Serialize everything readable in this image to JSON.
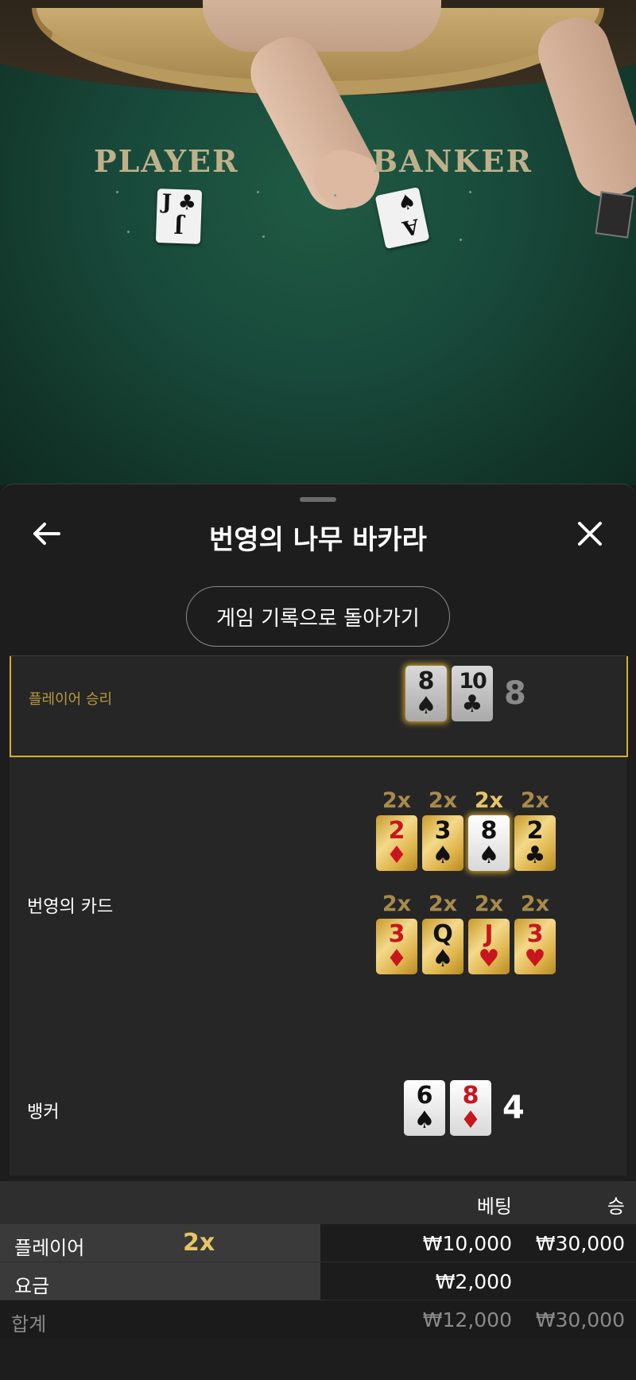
{
  "video": {
    "felt_player_label": "PLAYER",
    "felt_banker_label": "BANKER",
    "felt_cards": [
      {
        "rank": "J",
        "suit": "♣"
      },
      {
        "rank": "A",
        "suit": "♠"
      }
    ]
  },
  "header": {
    "title": "번영의 나무 바카라",
    "back_icon": "←",
    "close_icon": "✕"
  },
  "return_button_label": "게임 기록으로 돌아가기",
  "results": {
    "player": {
      "label": "플레이어 승리",
      "cards": [
        {
          "rank": "8",
          "suit": "♠"
        },
        {
          "rank": "10",
          "suit": "♣"
        }
      ],
      "total": "8"
    },
    "prosperity": {
      "label": "번영의 카드",
      "row1": [
        {
          "mult": "2x",
          "rank": "2",
          "suit": "♦"
        },
        {
          "mult": "2x",
          "rank": "3",
          "suit": "♠"
        },
        {
          "mult": "2x",
          "rank": "8",
          "suit": "♠"
        },
        {
          "mult": "2x",
          "rank": "2",
          "suit": "♣"
        }
      ],
      "row2": [
        {
          "mult": "2x",
          "rank": "3",
          "suit": "♦"
        },
        {
          "mult": "2x",
          "rank": "Q",
          "suit": "♠"
        },
        {
          "mult": "2x",
          "rank": "J",
          "suit": "♥"
        },
        {
          "mult": "2x",
          "rank": "3",
          "suit": "♥"
        }
      ]
    },
    "banker": {
      "label": "뱅커",
      "cards": [
        {
          "rank": "6",
          "suit": "♠"
        },
        {
          "rank": "8",
          "suit": "♦"
        }
      ],
      "total": "4"
    }
  },
  "bets": {
    "col_bet": "베팅",
    "col_win": "승",
    "rows": [
      {
        "name": "플레이어",
        "multiplier": "2x",
        "bet": "₩10,000",
        "win": "₩30,000"
      },
      {
        "name": "요금",
        "multiplier": "",
        "bet": "₩2,000",
        "win": ""
      }
    ],
    "total": {
      "name": "합계",
      "bet": "₩12,000",
      "win": "₩30,000"
    }
  },
  "colors": {
    "accent_gold": "#d4b12e",
    "multiplier_gold": "#e7c567",
    "card_red": "#c8161e",
    "felt_green": "#18493a"
  }
}
